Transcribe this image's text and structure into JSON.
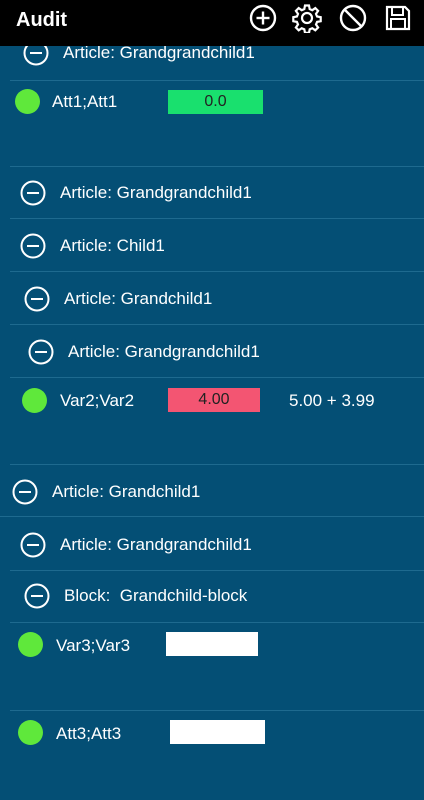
{
  "appbar": {
    "title": "Audit"
  },
  "colors": {
    "background": "#044f75",
    "ok_dot": "#5fe83b",
    "value_good": "#19e06e",
    "value_bad": "#f35572",
    "value_empty": "#ffffff"
  },
  "icons": [
    "add-circle-icon",
    "settings-gear-icon",
    "block-icon",
    "save-icon",
    "minus-circle-icon"
  ],
  "rows": {
    "r1": "Article: Grandgrandchild1",
    "r2": "Article: Grandgrandchild1",
    "r3": "Article: Child1",
    "r4": "Article: Grandchild1",
    "r5": "Article: Grandgrandchild1",
    "r6": "Article: Grandchild1",
    "r7": "Article: Grandgrandchild1",
    "r8": "Block:  Grandchild-block"
  },
  "values": {
    "v1": {
      "name": "Att1;Att1",
      "value": "0.0"
    },
    "v2": {
      "name": "Var2;Var2",
      "value": "4.00",
      "extra": "5.00 + 3.99"
    },
    "v3": {
      "name": "Var3;Var3",
      "value": ""
    },
    "v4": {
      "name": "Att3;Att3",
      "value": ""
    }
  }
}
